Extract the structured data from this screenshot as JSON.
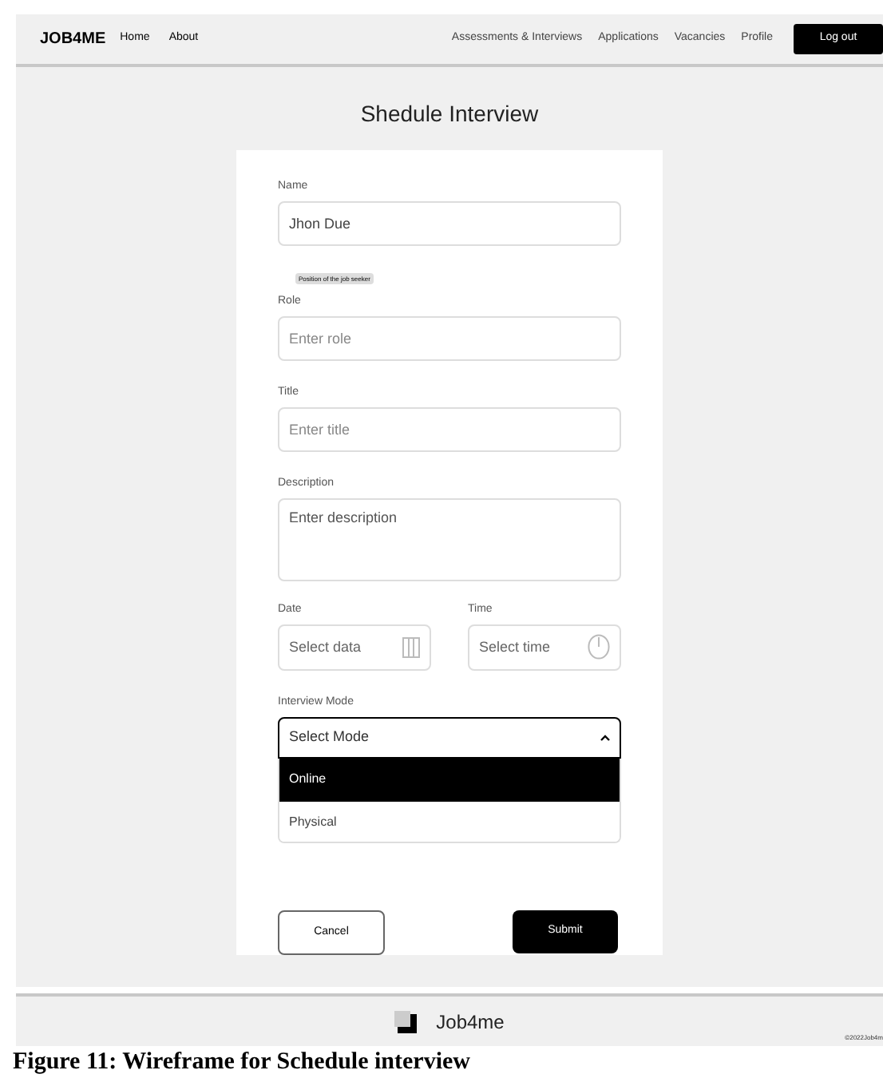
{
  "nav": {
    "brand": "JOB4ME",
    "left_links": [
      "Home",
      "About"
    ],
    "right_links": [
      "Assessments & Interviews",
      "Applications",
      "Vacancies",
      "Profile"
    ],
    "logout": "Log out"
  },
  "page_title": "Shedule Interview",
  "form": {
    "name": {
      "label": "Name",
      "value": "Jhon Due"
    },
    "tooltip": "Position of the job seeker",
    "role": {
      "label": "Role",
      "placeholder": "Enter role"
    },
    "title": {
      "label": "Title",
      "placeholder": "Enter title"
    },
    "description": {
      "label": "Description",
      "placeholder": "Enter description"
    },
    "date": {
      "label": "Date",
      "placeholder": "Select data"
    },
    "time": {
      "label": "Time",
      "placeholder": "Select time"
    },
    "mode": {
      "label": "Interview Mode",
      "placeholder": "Select Mode",
      "expanded": true,
      "options": [
        {
          "label": "Online",
          "selected": true
        },
        {
          "label": "Physical",
          "selected": false
        }
      ]
    },
    "cancel": "Cancel",
    "submit": "Submit"
  },
  "footer": {
    "brand": "Job4me",
    "copyright": "©2022Job4m"
  },
  "caption": "Figure 11: Wireframe for Schedule interview"
}
